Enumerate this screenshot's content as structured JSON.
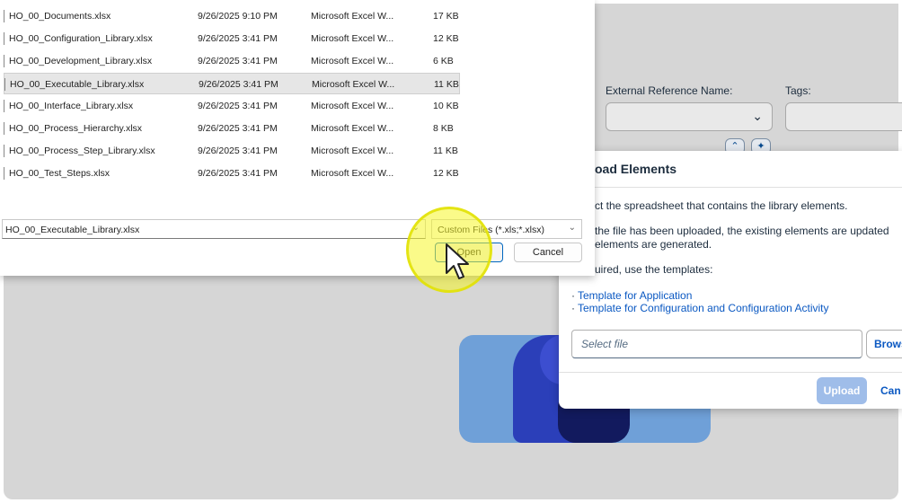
{
  "file_dialog": {
    "files": [
      {
        "name": "HO_00_Documents.xlsx",
        "date": "9/26/2025 9:10 PM",
        "type": "Microsoft Excel W...",
        "size": "17 KB",
        "selected": false
      },
      {
        "name": "HO_00_Configuration_Library.xlsx",
        "date": "9/26/2025 3:41 PM",
        "type": "Microsoft Excel W...",
        "size": "12 KB",
        "selected": false
      },
      {
        "name": "HO_00_Development_Library.xlsx",
        "date": "9/26/2025 3:41 PM",
        "type": "Microsoft Excel W...",
        "size": "6 KB",
        "selected": false
      },
      {
        "name": "HO_00_Executable_Library.xlsx",
        "date": "9/26/2025 3:41 PM",
        "type": "Microsoft Excel W...",
        "size": "11 KB",
        "selected": true
      },
      {
        "name": "HO_00_Interface_Library.xlsx",
        "date": "9/26/2025 3:41 PM",
        "type": "Microsoft Excel W...",
        "size": "10 KB",
        "selected": false
      },
      {
        "name": "HO_00_Process_Hierarchy.xlsx",
        "date": "9/26/2025 3:41 PM",
        "type": "Microsoft Excel W...",
        "size": "8 KB",
        "selected": false
      },
      {
        "name": "HO_00_Process_Step_Library.xlsx",
        "date": "9/26/2025 3:41 PM",
        "type": "Microsoft Excel W...",
        "size": "11 KB",
        "selected": false
      },
      {
        "name": "HO_00_Test_Steps.xlsx",
        "date": "9/26/2025 3:41 PM",
        "type": "Microsoft Excel W...",
        "size": "12 KB",
        "selected": false
      }
    ],
    "file_name_value": "HO_00_Executable_Library.xlsx",
    "file_type_value": "Custom Files (*.xls;*.xlsx)",
    "open_label": "Open",
    "cancel_label": "Cancel"
  },
  "filter_bar": {
    "external_reference_label": "External Reference Name:",
    "tags_label": "Tags:"
  },
  "upload_dialog": {
    "title": "oad Elements",
    "line1": "ct the spreadsheet that contains the library elements.",
    "line2a": "the file has been uploaded, the existing elements are updated",
    "line2b": "elements are generated.",
    "line3": "uired, use the templates:",
    "template_app": "Template for Application",
    "template_config": "Template for Configuration and Configuration Activity",
    "select_file_placeholder": "Select file",
    "browse_label": "Brows",
    "upload_label": "Upload",
    "cancel_label": "Can"
  },
  "colors": {
    "accent": "#0a58c2",
    "upload_disabled": "#9fbde9",
    "highlight": "#f5f528"
  }
}
